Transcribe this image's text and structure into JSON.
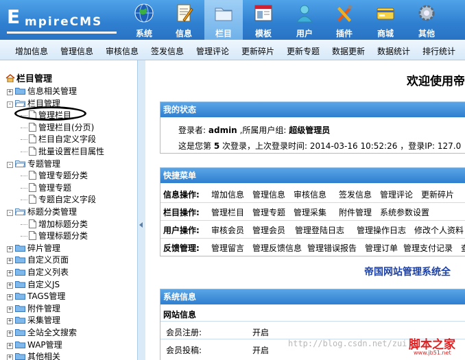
{
  "header": {
    "logo_text": "E",
    "logo_word": "mpireCMS",
    "nav": [
      {
        "label": "系统",
        "icon": "globe-icon"
      },
      {
        "label": "信息",
        "icon": "document-edit-icon"
      },
      {
        "label": "栏目",
        "icon": "folder-icon"
      },
      {
        "label": "模板",
        "icon": "template-window-icon"
      },
      {
        "label": "用户",
        "icon": "user-icon"
      },
      {
        "label": "插件",
        "icon": "tools-icon"
      },
      {
        "label": "商城",
        "icon": "shop-card-icon"
      },
      {
        "label": "其他",
        "icon": "gear-icon"
      }
    ],
    "active_index": 2
  },
  "toolbar": [
    "增加信息",
    "管理信息",
    "审核信息",
    "签发信息",
    "管理评论",
    "更新碎片",
    "更新专题",
    "数据更新",
    "数据统计",
    "排行统计"
  ],
  "tree": {
    "title": "栏目管理",
    "nodes": [
      {
        "label": "信息相关管理",
        "level": 0,
        "kind": "folder",
        "pm": "+"
      },
      {
        "label": "栏目管理",
        "level": 0,
        "kind": "folder-open",
        "pm": "-"
      },
      {
        "label": "管理栏目",
        "level": 1,
        "kind": "page"
      },
      {
        "label": "管理栏目(分页)",
        "level": 1,
        "kind": "page"
      },
      {
        "label": "栏目自定义字段",
        "level": 1,
        "kind": "page"
      },
      {
        "label": "批量设置栏目属性",
        "level": 1,
        "kind": "page"
      },
      {
        "label": "专题管理",
        "level": 0,
        "kind": "folder-open",
        "pm": "-"
      },
      {
        "label": "管理专题分类",
        "level": 1,
        "kind": "page"
      },
      {
        "label": "管理专题",
        "level": 1,
        "kind": "page"
      },
      {
        "label": "专题自定义字段",
        "level": 1,
        "kind": "page"
      },
      {
        "label": "标题分类管理",
        "level": 0,
        "kind": "folder-open",
        "pm": "-"
      },
      {
        "label": "增加标题分类",
        "level": 1,
        "kind": "page"
      },
      {
        "label": "管理标题分类",
        "level": 1,
        "kind": "page"
      },
      {
        "label": "碎片管理",
        "level": 0,
        "kind": "folder",
        "pm": "+"
      },
      {
        "label": "自定义页面",
        "level": 0,
        "kind": "folder",
        "pm": "+"
      },
      {
        "label": "自定义列表",
        "level": 0,
        "kind": "folder",
        "pm": "+"
      },
      {
        "label": "自定义JS",
        "level": 0,
        "kind": "folder",
        "pm": "+"
      },
      {
        "label": "TAGS管理",
        "level": 0,
        "kind": "folder",
        "pm": "+"
      },
      {
        "label": "附件管理",
        "level": 0,
        "kind": "folder",
        "pm": "+"
      },
      {
        "label": "采集管理",
        "level": 0,
        "kind": "folder",
        "pm": "+"
      },
      {
        "label": "全站全文搜索",
        "level": 0,
        "kind": "folder",
        "pm": "+"
      },
      {
        "label": "WAP管理",
        "level": 0,
        "kind": "folder",
        "pm": "+"
      },
      {
        "label": "其他相关",
        "level": 0,
        "kind": "folder",
        "pm": "+"
      }
    ]
  },
  "main": {
    "welcome": "欢迎使用帝",
    "status": {
      "title": "我的状态",
      "login_label": "登录者:",
      "user": "admin",
      "group_label": ",所属用户组:",
      "group": "超级管理员",
      "visit_prefix": "这是您第",
      "count": "5",
      "visit_mid": "次登录，上次登录时间:",
      "last_time": "2014-03-16 10:52:26",
      "ip_label": "，登录IP:",
      "ip": "127.0"
    },
    "quick": {
      "title": "快捷菜单",
      "rows": [
        {
          "cat": "信息操作:",
          "links": [
            "增加信息",
            "管理信息",
            "审核信息",
            "签发信息",
            "管理评论",
            "更新碎片"
          ]
        },
        {
          "cat": "栏目操作:",
          "links": [
            "管理栏目",
            "管理专题",
            "管理采集",
            "附件管理",
            "系统参数设置"
          ]
        },
        {
          "cat": "用户操作:",
          "links": [
            "审核会员",
            "管理会员",
            "管理登陆日志",
            "管理操作日志",
            "修改个人资料"
          ]
        },
        {
          "cat": "反馈管理:",
          "links": [
            "管理留言",
            "管理反馈信息",
            "管理错误报告",
            "管理订单",
            "管理支付记录",
            "查"
          ]
        }
      ]
    },
    "tagline": "帝国网站管理系统全",
    "sysinfo": {
      "title": "系统信息",
      "sub": "网站信息",
      "rows": [
        {
          "label": "会员注册:",
          "value": "开启"
        },
        {
          "label": "会员投稿:",
          "value": "开启"
        }
      ]
    }
  },
  "watermark": "http://blog.csdn.net/zui",
  "site_brand": "脚本之家",
  "site_brand_sub": "www.jb51.net",
  "colors": {
    "header_blue": "#2f7fd0",
    "panel_head": "#3a8ad6",
    "tagline": "#1a3fa6",
    "brand_red": "#e02020"
  }
}
